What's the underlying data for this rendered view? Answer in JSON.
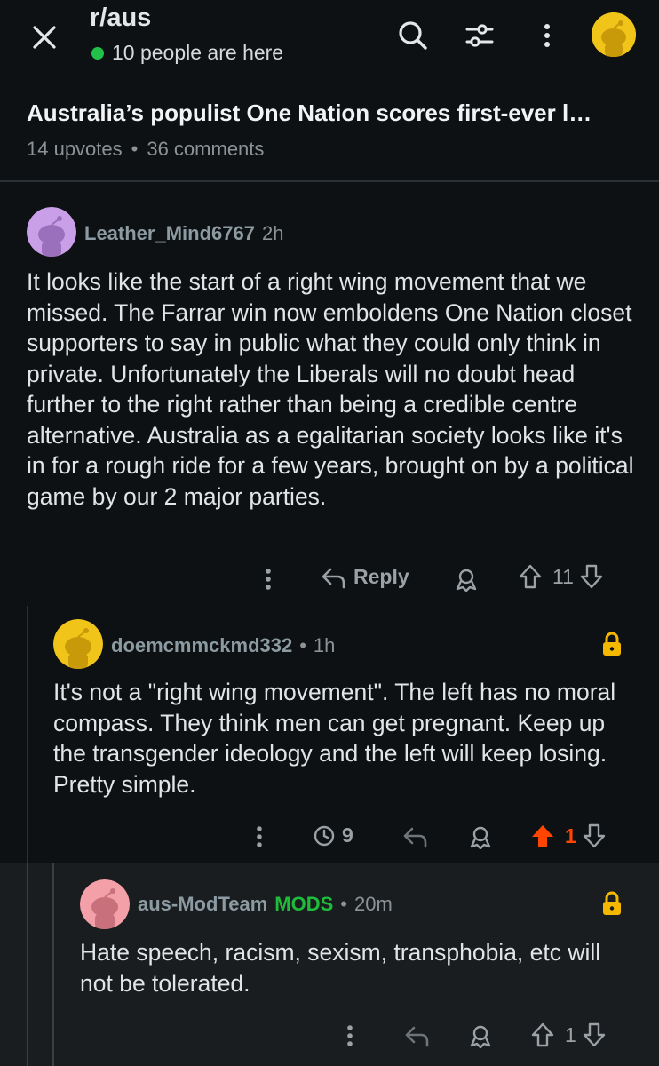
{
  "header": {
    "subreddit": "r/aus",
    "online_text": "10 people are here",
    "close_icon": "close-icon",
    "search_icon": "search-icon",
    "filter_icon": "sliders-icon",
    "more_icon": "more-vertical-icon"
  },
  "post": {
    "title": "Australia’s populist One Nation scores first-ever l…",
    "upvotes": "14 upvotes",
    "separator": "•",
    "comments": "36 comments"
  },
  "comments": [
    {
      "username": "Leather_Mind6767",
      "time": "2h",
      "body": "It looks like the start of a right wing movement that we missed. The Farrar win now emboldens One Nation closet supporters to say in public what they could only think in private. Unfortunately the Liberals will no doubt head further to the right rather than being a credible centre alternative. Australia as a egalitarian society looks like it's in for a rough ride for a few years, brought on by a political game by our 2 major parties.",
      "reply_label": "Reply",
      "score": "11",
      "avatar_color": "#c9a0e8"
    },
    {
      "username": "doemcmmckmd332",
      "separator": "•",
      "time": "1h",
      "body": "It's not a \"right wing movement\". The left has no moral compass. They think men can get pregnant. Keep up the transgender ideology and the left will keep losing. Pretty simple.",
      "pending_count": "9",
      "score": "1",
      "avatar_color": "#f0c419"
    },
    {
      "username": "aus-ModTeam",
      "badge": "MODS",
      "separator": "•",
      "time": "20m",
      "body": "Hate speech, racism, sexism, transphobia, etc will not be tolerated.",
      "score": "1",
      "avatar_color": "#f4a0a8"
    }
  ],
  "colors": {
    "background": "#0e1113",
    "online_dot": "#22c24a",
    "upvote_active": "#ff4500",
    "lock": "#f5b800",
    "mods_badge": "#1ebc3a"
  }
}
